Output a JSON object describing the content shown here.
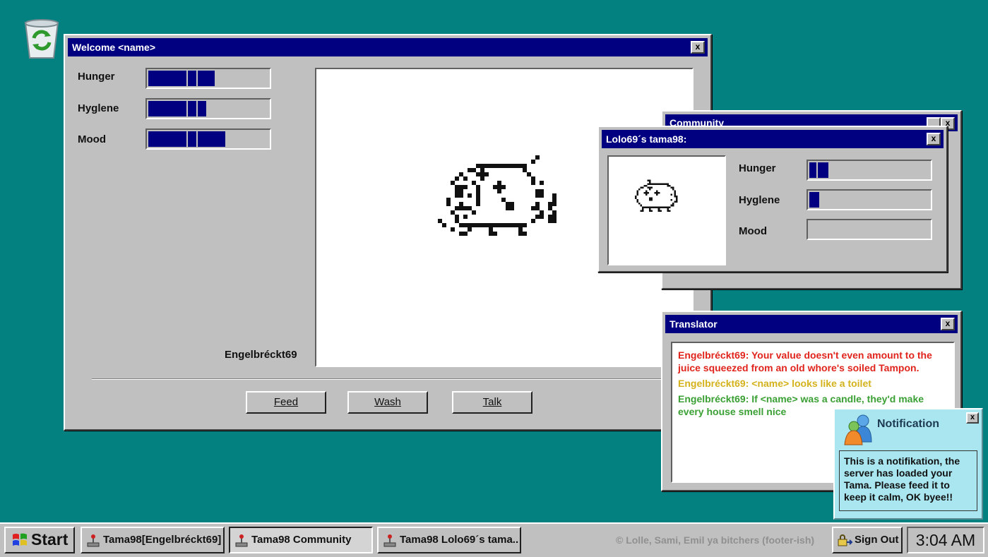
{
  "desktop": {
    "recycle_bin_icon": "recycle-bin-icon"
  },
  "main_window": {
    "title": "Welcome <name>",
    "close_label": "x",
    "stats": [
      {
        "label": "Hunger",
        "level": 0.55
      },
      {
        "label": "Hyglene",
        "level": 0.48
      },
      {
        "label": "Mood",
        "level": 0.64
      }
    ],
    "username": "Engelbréckt69",
    "buttons": {
      "feed": "Feed",
      "wash": "Wash",
      "talk": "Talk"
    }
  },
  "community_window": {
    "title": "Community"
  },
  "friend_window": {
    "title": "Lolo69´s tama98:",
    "close_label": "x",
    "stats": [
      {
        "label": "Hunger",
        "level": 0.16
      },
      {
        "label": "Hyglene",
        "level": 0.08
      },
      {
        "label": "Mood",
        "level": 0.0
      }
    ]
  },
  "translator": {
    "title": "Translator",
    "close_label": "x",
    "messages": [
      {
        "text": "Engelbréckt69: Your value doesn't even amount to the juice squeezed from an old whore's soiled Tampon.",
        "color": "#e0241c"
      },
      {
        "text": "Engelbréckt69: <name> looks like a toilet",
        "color": "#d4b21c"
      },
      {
        "text": "Engelbréckt69: If <name> was a candle, they'd make every house smell nice",
        "color": "#3aa034"
      }
    ]
  },
  "notification": {
    "title": "Notification",
    "close_label": "x",
    "icon": "messenger-people-icon",
    "body": "This is a notifikation, the server has loaded your Tama. Please feed it to keep it calm, OK byee!!"
  },
  "taskbar": {
    "start_label": "Start",
    "tasks": [
      "Tama98[Engelbréckt69]",
      "Tama98 Community",
      "Tama98 Lolo69´s tama.."
    ],
    "footer": "© Lolle, Sami, Emil ya bitchers (footer-ish)",
    "sign_out_label": "Sign Out",
    "clock": "3:04 AM"
  },
  "colors": {
    "desktop": "#038080",
    "titlebar": "#000080",
    "window": "#c0c0c0"
  }
}
